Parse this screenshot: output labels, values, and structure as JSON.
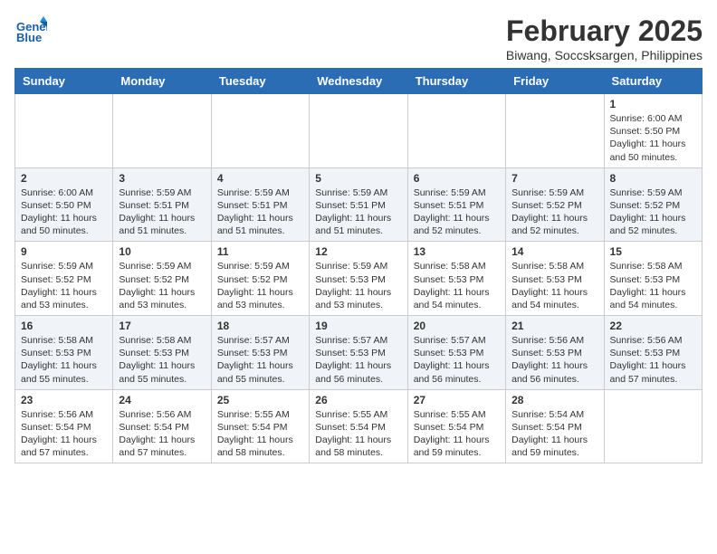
{
  "header": {
    "logo_line1": "General",
    "logo_line2": "Blue",
    "title": "February 2025",
    "subtitle": "Biwang, Soccsksargen, Philippines"
  },
  "weekdays": [
    "Sunday",
    "Monday",
    "Tuesday",
    "Wednesday",
    "Thursday",
    "Friday",
    "Saturday"
  ],
  "weeks": [
    [
      {
        "day": "",
        "info": ""
      },
      {
        "day": "",
        "info": ""
      },
      {
        "day": "",
        "info": ""
      },
      {
        "day": "",
        "info": ""
      },
      {
        "day": "",
        "info": ""
      },
      {
        "day": "",
        "info": ""
      },
      {
        "day": "1",
        "info": "Sunrise: 6:00 AM\nSunset: 5:50 PM\nDaylight: 11 hours and 50 minutes."
      }
    ],
    [
      {
        "day": "2",
        "info": "Sunrise: 6:00 AM\nSunset: 5:50 PM\nDaylight: 11 hours and 50 minutes."
      },
      {
        "day": "3",
        "info": "Sunrise: 5:59 AM\nSunset: 5:51 PM\nDaylight: 11 hours and 51 minutes."
      },
      {
        "day": "4",
        "info": "Sunrise: 5:59 AM\nSunset: 5:51 PM\nDaylight: 11 hours and 51 minutes."
      },
      {
        "day": "5",
        "info": "Sunrise: 5:59 AM\nSunset: 5:51 PM\nDaylight: 11 hours and 51 minutes."
      },
      {
        "day": "6",
        "info": "Sunrise: 5:59 AM\nSunset: 5:51 PM\nDaylight: 11 hours and 52 minutes."
      },
      {
        "day": "7",
        "info": "Sunrise: 5:59 AM\nSunset: 5:52 PM\nDaylight: 11 hours and 52 minutes."
      },
      {
        "day": "8",
        "info": "Sunrise: 5:59 AM\nSunset: 5:52 PM\nDaylight: 11 hours and 52 minutes."
      }
    ],
    [
      {
        "day": "9",
        "info": "Sunrise: 5:59 AM\nSunset: 5:52 PM\nDaylight: 11 hours and 53 minutes."
      },
      {
        "day": "10",
        "info": "Sunrise: 5:59 AM\nSunset: 5:52 PM\nDaylight: 11 hours and 53 minutes."
      },
      {
        "day": "11",
        "info": "Sunrise: 5:59 AM\nSunset: 5:52 PM\nDaylight: 11 hours and 53 minutes."
      },
      {
        "day": "12",
        "info": "Sunrise: 5:59 AM\nSunset: 5:53 PM\nDaylight: 11 hours and 53 minutes."
      },
      {
        "day": "13",
        "info": "Sunrise: 5:58 AM\nSunset: 5:53 PM\nDaylight: 11 hours and 54 minutes."
      },
      {
        "day": "14",
        "info": "Sunrise: 5:58 AM\nSunset: 5:53 PM\nDaylight: 11 hours and 54 minutes."
      },
      {
        "day": "15",
        "info": "Sunrise: 5:58 AM\nSunset: 5:53 PM\nDaylight: 11 hours and 54 minutes."
      }
    ],
    [
      {
        "day": "16",
        "info": "Sunrise: 5:58 AM\nSunset: 5:53 PM\nDaylight: 11 hours and 55 minutes."
      },
      {
        "day": "17",
        "info": "Sunrise: 5:58 AM\nSunset: 5:53 PM\nDaylight: 11 hours and 55 minutes."
      },
      {
        "day": "18",
        "info": "Sunrise: 5:57 AM\nSunset: 5:53 PM\nDaylight: 11 hours and 55 minutes."
      },
      {
        "day": "19",
        "info": "Sunrise: 5:57 AM\nSunset: 5:53 PM\nDaylight: 11 hours and 56 minutes."
      },
      {
        "day": "20",
        "info": "Sunrise: 5:57 AM\nSunset: 5:53 PM\nDaylight: 11 hours and 56 minutes."
      },
      {
        "day": "21",
        "info": "Sunrise: 5:56 AM\nSunset: 5:53 PM\nDaylight: 11 hours and 56 minutes."
      },
      {
        "day": "22",
        "info": "Sunrise: 5:56 AM\nSunset: 5:53 PM\nDaylight: 11 hours and 57 minutes."
      }
    ],
    [
      {
        "day": "23",
        "info": "Sunrise: 5:56 AM\nSunset: 5:54 PM\nDaylight: 11 hours and 57 minutes."
      },
      {
        "day": "24",
        "info": "Sunrise: 5:56 AM\nSunset: 5:54 PM\nDaylight: 11 hours and 57 minutes."
      },
      {
        "day": "25",
        "info": "Sunrise: 5:55 AM\nSunset: 5:54 PM\nDaylight: 11 hours and 58 minutes."
      },
      {
        "day": "26",
        "info": "Sunrise: 5:55 AM\nSunset: 5:54 PM\nDaylight: 11 hours and 58 minutes."
      },
      {
        "day": "27",
        "info": "Sunrise: 5:55 AM\nSunset: 5:54 PM\nDaylight: 11 hours and 59 minutes."
      },
      {
        "day": "28",
        "info": "Sunrise: 5:54 AM\nSunset: 5:54 PM\nDaylight: 11 hours and 59 minutes."
      },
      {
        "day": "",
        "info": ""
      }
    ]
  ]
}
